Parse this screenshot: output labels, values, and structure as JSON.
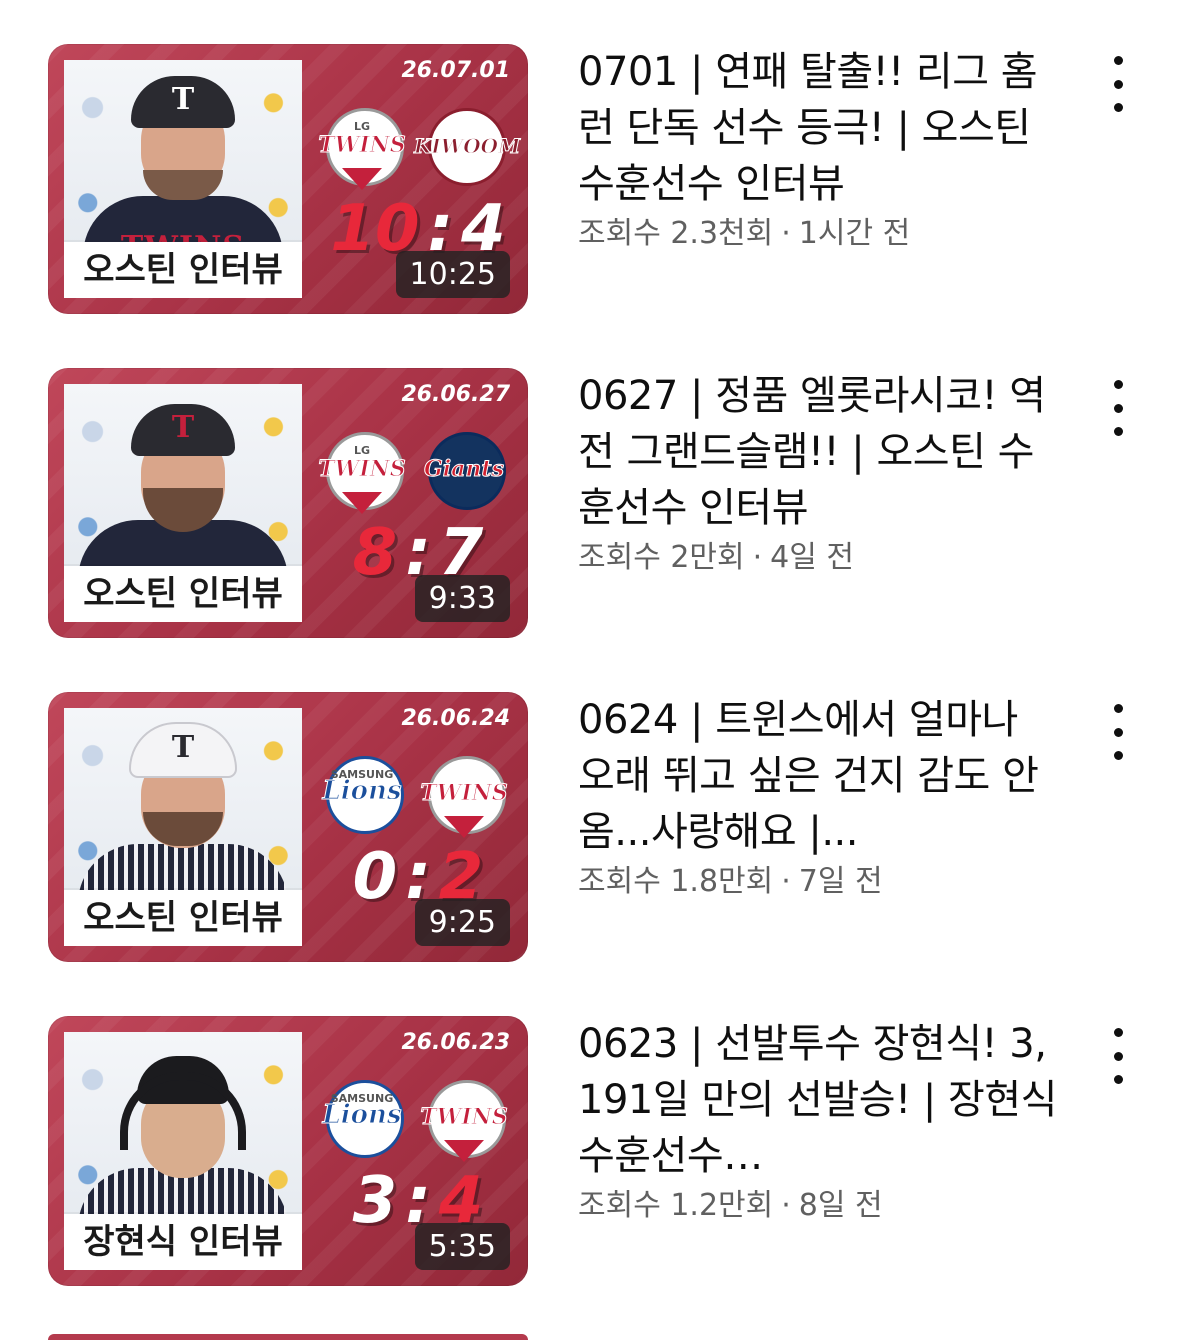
{
  "videos": [
    {
      "date": "26.07.01",
      "name_label": "오스틴 인터뷰",
      "team_left": "TWINS",
      "team_left_sub": "LG",
      "team_right": "KIWOOM",
      "score_left": "10",
      "score_sep": ":",
      "score_right": "4",
      "duration": "10:25",
      "title": "0701 | 연패 탈출!! 리그 홈런 단독 선수 등극! | 오스틴 수훈선수 인터뷰",
      "views": "조회수 2.3천회",
      "age": "1시간 전"
    },
    {
      "date": "26.06.27",
      "name_label": "오스틴 인터뷰",
      "team_left": "TWINS",
      "team_left_sub": "LG",
      "team_right": "Giants",
      "score_left": "8",
      "score_sep": ":",
      "score_right": "7",
      "duration": "9:33",
      "title": "0627 | 정품 엘롯라시코! 역전 그랜드슬램!! | 오스틴 수훈선수 인터뷰",
      "views": "조회수 2만회",
      "age": "4일 전"
    },
    {
      "date": "26.06.24",
      "name_label": "오스틴 인터뷰",
      "team_left": "Lions",
      "team_left_sub": "SAMSUNG",
      "team_right": "TWINS",
      "score_left": "0",
      "score_sep": ":",
      "score_right": "2",
      "duration": "9:25",
      "title": "0624 | 트윈스에서 얼마나 오래 뛰고 싶은 건지 감도 안 옴...사랑해요 |...",
      "views": "조회수 1.8만회",
      "age": "7일 전"
    },
    {
      "date": "26.06.23",
      "name_label": "장현식 인터뷰",
      "team_left": "Lions",
      "team_left_sub": "SAMSUNG",
      "team_right": "TWINS",
      "score_left": "3",
      "score_sep": ":",
      "score_right": "4",
      "duration": "5:35",
      "title": "0623 | 선발투수 장현식! 3,191일 만의 선발승! | 장현식 수훈선수…",
      "views": "조회수 1.2만회",
      "age": "8일 전"
    }
  ],
  "meta_separator": "·",
  "icons": {
    "more": "more-vert-icon",
    "lg_cap_letter": "T"
  },
  "colors": {
    "thumb_bg": "#a83246",
    "score_red": "#e8283a",
    "text_primary": "#0f0f0f",
    "text_secondary": "#606060"
  }
}
